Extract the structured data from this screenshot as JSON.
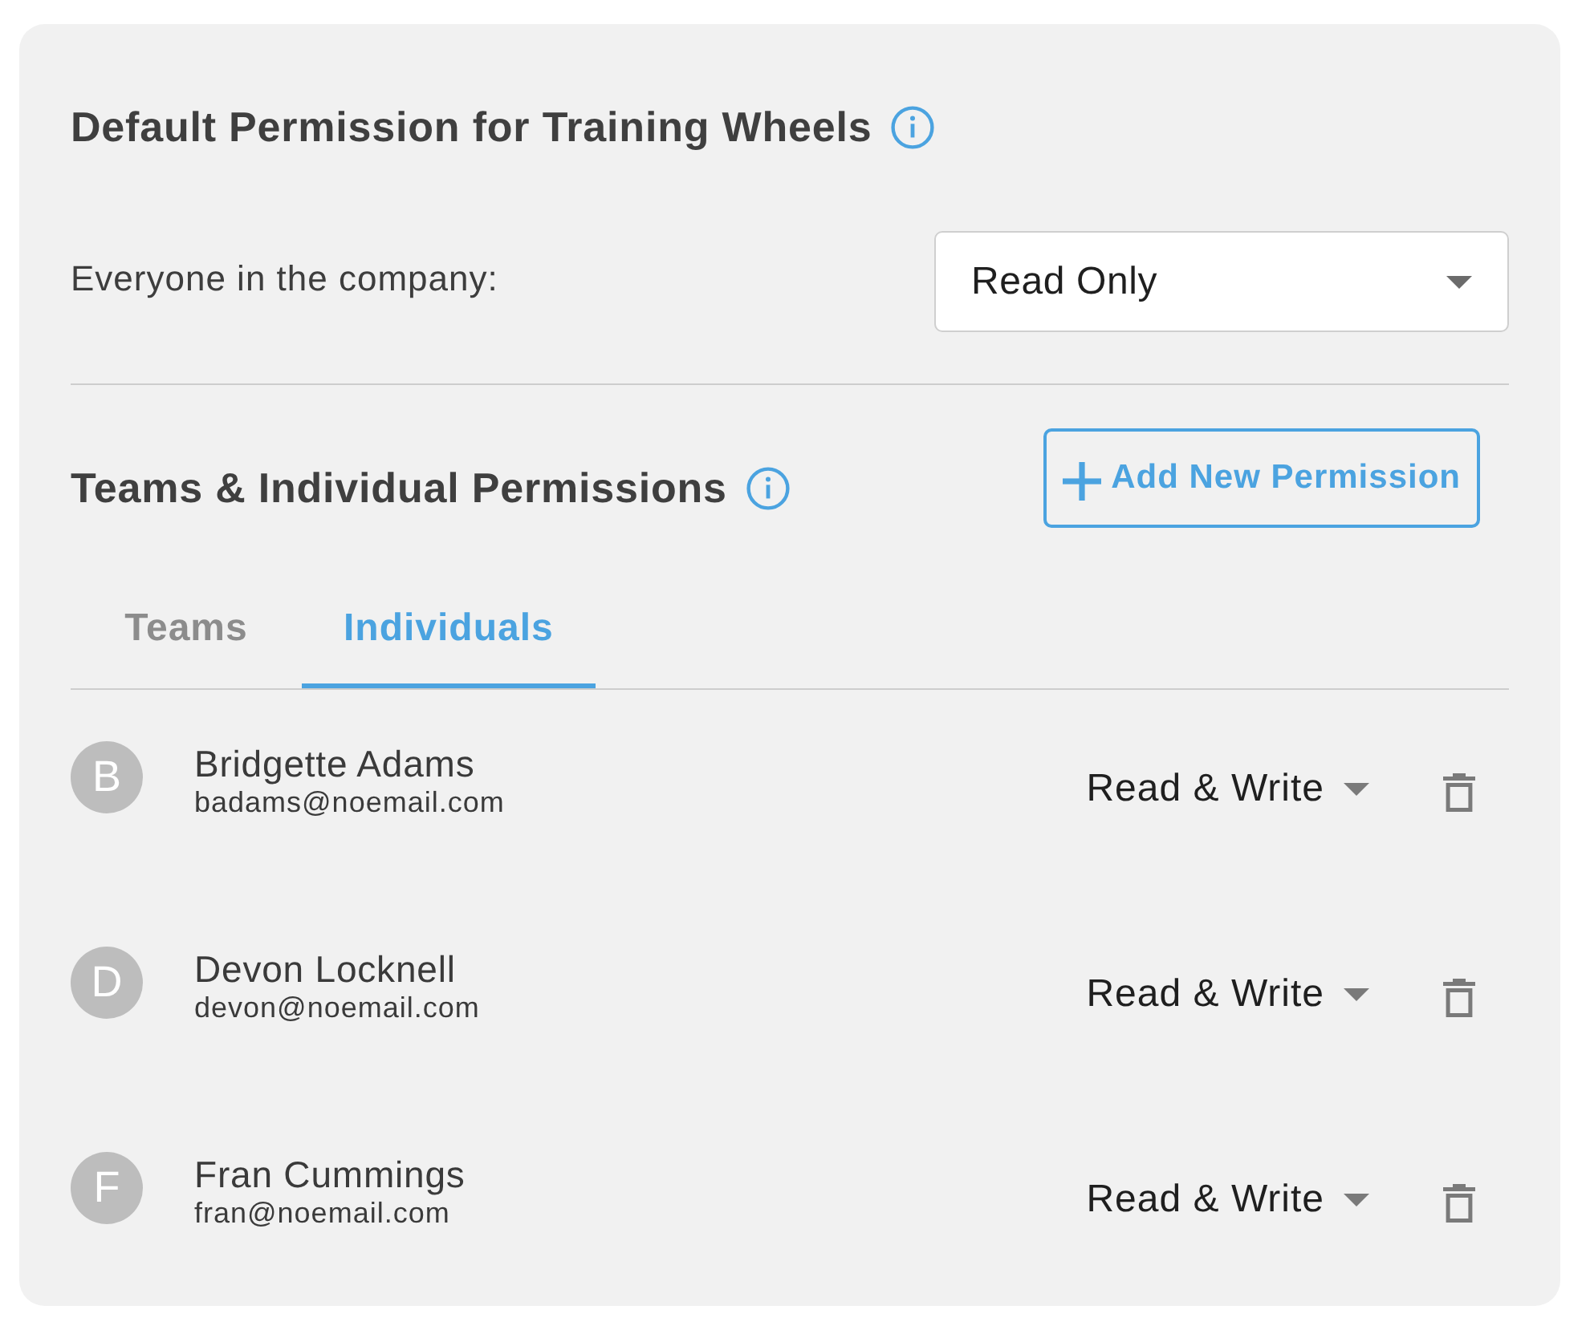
{
  "default_permission": {
    "title": "Default Permission for Training Wheels",
    "label": "Everyone in the company:",
    "select": {
      "value": "Read Only"
    }
  },
  "team_permissions": {
    "title": "Teams & Individual Permissions",
    "add_button": "Add New Permission",
    "tabs": [
      {
        "label": "Teams",
        "selected": false
      },
      {
        "label": "Individuals",
        "selected": true
      }
    ],
    "individuals": [
      {
        "initial": "B",
        "name": "Bridgette Adams",
        "email": "badams@noemail.com",
        "permission": "Read & Write"
      },
      {
        "initial": "D",
        "name": "Devon Locknell",
        "email": "devon@noemail.com",
        "permission": "Read & Write"
      },
      {
        "initial": "F",
        "name": "Fran Cummings",
        "email": "fran@noemail.com",
        "permission": "Read & Write"
      }
    ]
  }
}
